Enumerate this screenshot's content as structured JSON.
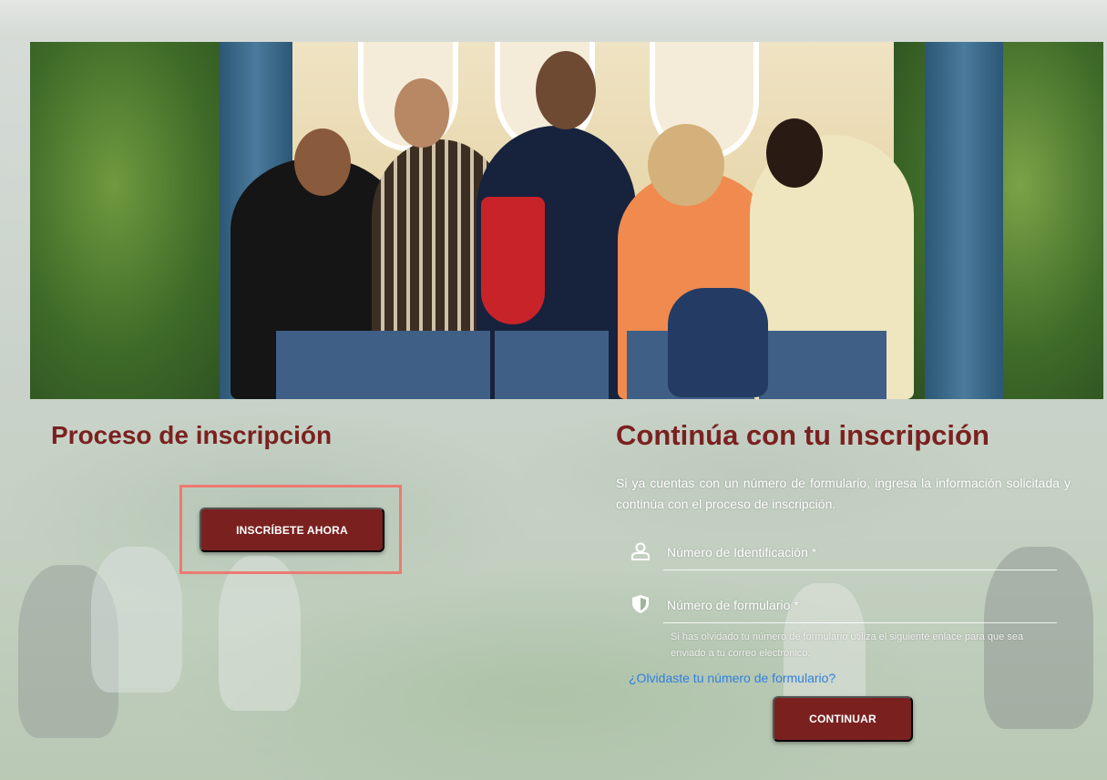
{
  "left": {
    "title": "Proceso de inscripción",
    "inscribe_button": "INSCRÍBETE AHORA"
  },
  "right": {
    "title": "Continúa con tu inscripción",
    "intro": "Si ya cuentas con un número de formulario, ingresa la información solicitada y continúa con el proceso de inscripción.",
    "id_field": {
      "placeholder": "Número de Identificación *",
      "value": "",
      "icon": "user-icon"
    },
    "form_field": {
      "placeholder": "Número de formulario *",
      "value": "",
      "icon": "shield-icon"
    },
    "help_text": "Si has olvidado tu número de formulario utiliza el siguiente enlace para que sea enviado a tu correo electrónico.",
    "forgot_link": "¿Olvidaste tu número de formulario?",
    "continue_button": "CONTINUAR"
  },
  "colors": {
    "brand": "#7a2120",
    "link": "#2f7fe0",
    "highlight": "#ec7a71"
  }
}
